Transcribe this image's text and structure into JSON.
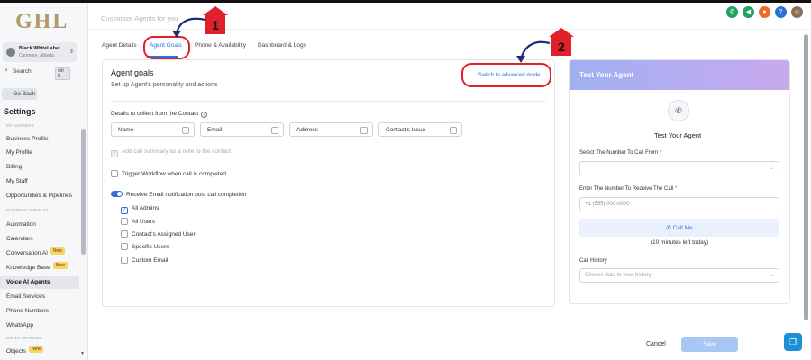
{
  "sidebar": {
    "logo": "GHL",
    "account": {
      "name": "Black WhiteLabel",
      "location": "Canmore, Alberta"
    },
    "search": {
      "label": "Search",
      "shortcut": "ctrl K"
    },
    "go_back": "← Go Back",
    "settings_title": "Settings",
    "sections": {
      "my_business": "MY BUSINESS",
      "business_services": "BUSINESS SERVICES",
      "other_settings": "OTHER SETTINGS"
    },
    "items": [
      {
        "label": "Business Profile"
      },
      {
        "label": "My Profile"
      },
      {
        "label": "Billing"
      },
      {
        "label": "My Staff"
      },
      {
        "label": "Opportunities & Pipelines"
      },
      {
        "label": "Automation"
      },
      {
        "label": "Calendars"
      },
      {
        "label": "Conversation AI",
        "badge": "New"
      },
      {
        "label": "Knowledge Base",
        "badge": "New"
      },
      {
        "label": "Voice AI Agents",
        "active": true
      },
      {
        "label": "Email Services"
      },
      {
        "label": "Phone Numbers"
      },
      {
        "label": "WhatsApp"
      },
      {
        "label": "Objects",
        "badge": "New"
      }
    ]
  },
  "header": {
    "title": "Customize Agents for you",
    "icon_colors": {
      "phone": "#1ea362",
      "megaphone": "#1ea362",
      "bell": "#f06a24",
      "help": "#2f6fd6"
    },
    "help": "?"
  },
  "tabs": [
    {
      "label": "Agent Details"
    },
    {
      "label": "Agent Goals",
      "active": true
    },
    {
      "label": "Phone & Availability"
    },
    {
      "label": "Dashboard & Logs"
    }
  ],
  "goals": {
    "title": "Agent goals",
    "subtitle": "Set up Agent's personality and actions",
    "advanced_link": "Switch to advanced mode",
    "collect_label": "Details to collect from the Contact",
    "fields": [
      "Name",
      "Email",
      "Address",
      "Contact's Issue"
    ],
    "call_summary": "Add call summary as a note to the contact",
    "trigger_workflow": "Trigger Workflow when call is completed",
    "email_notification": "Receive Email notification post call completion",
    "recipients": [
      {
        "label": "All Admins",
        "checked": true
      },
      {
        "label": "All Users"
      },
      {
        "label": "Contact's Assigned User"
      },
      {
        "label": "Specific Users"
      },
      {
        "label": "Custom Email"
      }
    ]
  },
  "test": {
    "head_title": "Test Your Agent",
    "title": "Test Your Agent",
    "from_label": "Select The Number To Call From",
    "to_label": "Enter The Number To Receive The Call",
    "required_mark": "*",
    "phone_placeholder": "+1 (555) 000-0000",
    "call_me": "Call Me",
    "minutes_left": "(10 minutes left today)",
    "history_label": "Call History",
    "history_placeholder": "Choose date to view history"
  },
  "footer": {
    "cancel": "Cancel",
    "save": "Save"
  },
  "annotations": {
    "one": "1",
    "two": "2",
    "color": "#e0202a"
  }
}
